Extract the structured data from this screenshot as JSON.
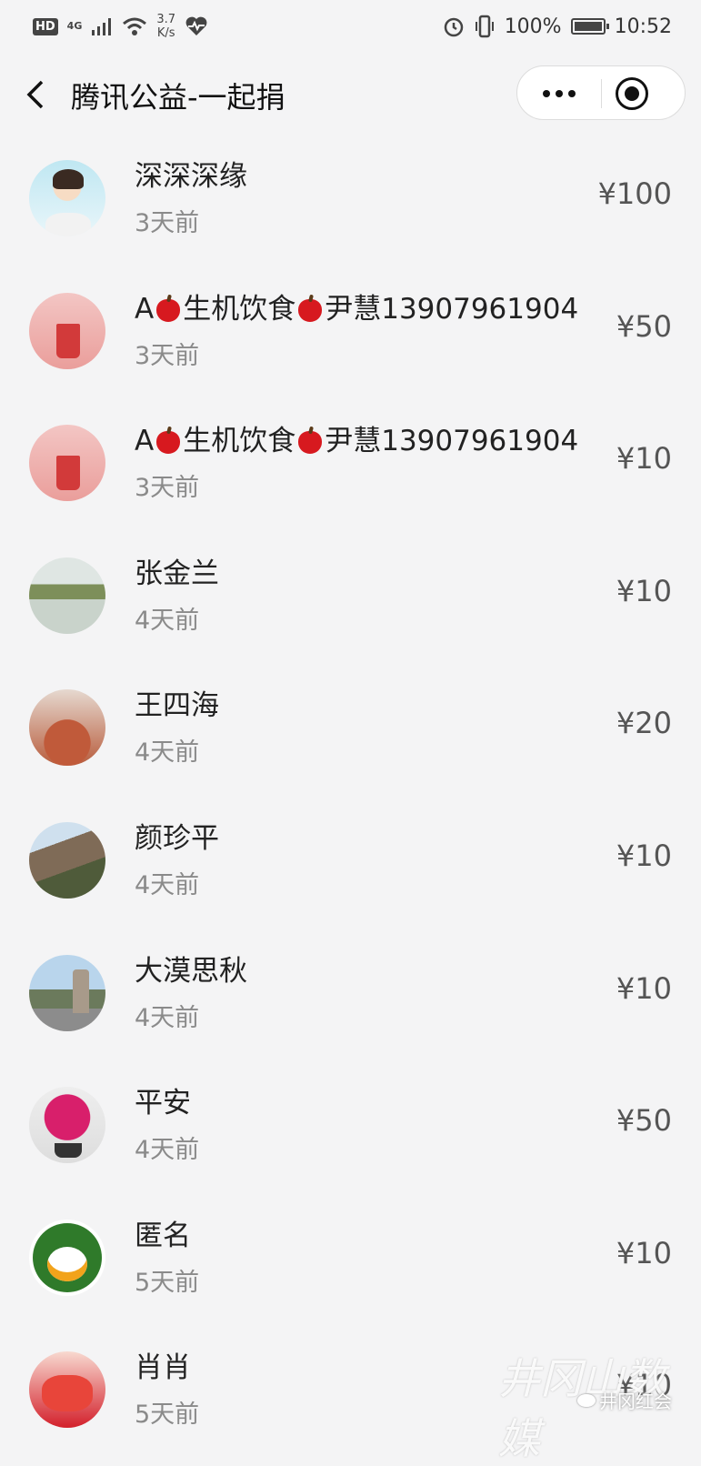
{
  "status_bar": {
    "hd": "HD",
    "network": "4G",
    "speed_value": "3.7",
    "speed_unit": "K/s",
    "battery": "100%",
    "time": "10:52"
  },
  "navbar": {
    "back_icon": "chevron-left",
    "title": "腾讯公益-一起捐",
    "more_icon": "three-dots",
    "close_icon": "target-circle"
  },
  "donors": [
    {
      "name": "深深深缘",
      "time": "3天前",
      "amount": "¥100",
      "avatar": "cartoon-boy"
    },
    {
      "name_pre": "A",
      "name_mid": "生机饮食",
      "name_post": "尹慧13907961904",
      "time": "3天前",
      "amount": "¥50",
      "avatar": "juice-cup"
    },
    {
      "name_pre": "A",
      "name_mid": "生机饮食",
      "name_post": "尹慧13907961904",
      "time": "3天前",
      "amount": "¥10",
      "avatar": "juice-cup"
    },
    {
      "name": "张金兰",
      "time": "4天前",
      "amount": "¥10",
      "avatar": "lake-landscape"
    },
    {
      "name": "王四海",
      "time": "4天前",
      "amount": "¥20",
      "avatar": "red-canyon"
    },
    {
      "name": "颜珍平",
      "time": "4天前",
      "amount": "¥10",
      "avatar": "mountain"
    },
    {
      "name": "大漠思秋",
      "time": "4天前",
      "amount": "¥10",
      "avatar": "monument"
    },
    {
      "name": "平安",
      "time": "4天前",
      "amount": "¥50",
      "avatar": "bonsai-flowers"
    },
    {
      "name": "匿名",
      "time": "5天前",
      "amount": "¥10",
      "avatar": "qq-penguin"
    },
    {
      "name": "肖肖",
      "time": "5天前",
      "amount": "¥10",
      "avatar": "red-dolls"
    }
  ],
  "watermark": {
    "calligraphy": "井冈山数媒",
    "account": "井冈红会"
  }
}
